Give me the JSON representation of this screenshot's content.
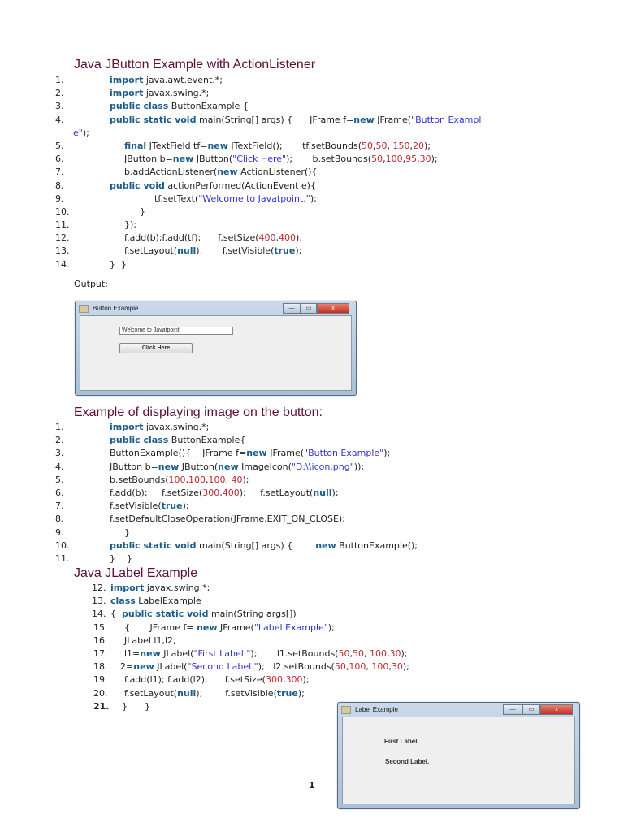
{
  "section1": {
    "heading": "Java JButton Example with ActionListener",
    "lines": [
      {
        "num": "1.",
        "segs": [
          [
            "import",
            "k"
          ],
          [
            " java.awt.event.*;",
            "p"
          ]
        ]
      },
      {
        "num": "2.",
        "segs": [
          [
            "import",
            "k"
          ],
          [
            " javax.swing.*;",
            "p"
          ]
        ]
      },
      {
        "num": "3.",
        "segs": [
          [
            "public class",
            "k"
          ],
          [
            " ButtonExample {",
            "p"
          ]
        ]
      },
      {
        "num": "4.",
        "segs": [
          [
            "public static void",
            "k"
          ],
          [
            " main(String[] args) {      JFrame f=",
            "p"
          ],
          [
            "new",
            "k"
          ],
          [
            " JFrame(",
            "p"
          ],
          [
            "\"Button Exampl",
            "s"
          ]
        ]
      },
      {
        "num": "",
        "segs": [
          [
            "e\"",
            "s"
          ],
          [
            ");",
            "p"
          ]
        ]
      },
      {
        "num": "5.",
        "segs": [
          [
            "final",
            "k"
          ],
          [
            " JTextField tf=",
            "p"
          ],
          [
            "new",
            "k"
          ],
          [
            " JTextField();       tf.setBounds(",
            "p"
          ],
          [
            "50",
            "n"
          ],
          [
            ",",
            "p"
          ],
          [
            "50",
            "n"
          ],
          [
            ", ",
            "p"
          ],
          [
            "150",
            "n"
          ],
          [
            ",",
            "p"
          ],
          [
            "20",
            "n"
          ],
          [
            ");",
            "p"
          ]
        ]
      },
      {
        "num": "6.",
        "segs": [
          [
            "JButton b=",
            "p"
          ],
          [
            "new",
            "k"
          ],
          [
            " JButton(",
            "p"
          ],
          [
            "\"Click Here\"",
            "s"
          ],
          [
            ");       b.setBounds(",
            "p"
          ],
          [
            "50",
            "n"
          ],
          [
            ",",
            "p"
          ],
          [
            "100",
            "n"
          ],
          [
            ",",
            "p"
          ],
          [
            "95",
            "n"
          ],
          [
            ",",
            "p"
          ],
          [
            "30",
            "n"
          ],
          [
            ");",
            "p"
          ]
        ]
      },
      {
        "num": "7.",
        "segs": [
          [
            "b.addActionListener(",
            "p"
          ],
          [
            "new",
            "k"
          ],
          [
            " ActionListener(){",
            "p"
          ]
        ]
      },
      {
        "num": "8.",
        "segs": [
          [
            "public void",
            "k"
          ],
          [
            " actionPerformed(ActionEvent e){",
            "p"
          ]
        ]
      },
      {
        "num": "9.",
        "segs": [
          [
            "tf.setText(",
            "p"
          ],
          [
            "\"Welcome to Javatpoint.\"",
            "s"
          ],
          [
            ");",
            "p"
          ]
        ]
      },
      {
        "num": "10.",
        "segs": [
          [
            "}",
            "p"
          ]
        ]
      },
      {
        "num": "11.",
        "segs": [
          [
            "});",
            "p"
          ]
        ]
      },
      {
        "num": "12.",
        "segs": [
          [
            "f.add(b);f.add(tf);      f.setSize(",
            "p"
          ],
          [
            "400",
            "n"
          ],
          [
            ",",
            "p"
          ],
          [
            "400",
            "n"
          ],
          [
            ");",
            "p"
          ]
        ]
      },
      {
        "num": "13.",
        "segs": [
          [
            "f.setLayout(",
            "p"
          ],
          [
            "null",
            "k"
          ],
          [
            ");       f.setVisible(",
            "p"
          ],
          [
            "true",
            "k"
          ],
          [
            ");",
            "p"
          ]
        ]
      },
      {
        "num": "14.",
        "segs": [
          [
            "}  }",
            "p"
          ]
        ]
      }
    ],
    "output_label": "Output:",
    "window": {
      "title": "Button Example",
      "textfield": "Welcome to Javatpoint.",
      "button": "Click Here",
      "close": "x"
    }
  },
  "section2": {
    "heading": "Example of displaying image on the button:",
    "lines": [
      {
        "num": "1.",
        "segs": [
          [
            "import",
            "k"
          ],
          [
            " javax.swing.*;",
            "p"
          ]
        ]
      },
      {
        "num": "2.",
        "segs": [
          [
            "public class",
            "k"
          ],
          [
            " ButtonExample{",
            "p"
          ]
        ]
      },
      {
        "num": "3.",
        "segs": [
          [
            "ButtonExample(){    JFrame f=",
            "p"
          ],
          [
            "new",
            "k"
          ],
          [
            " JFrame(",
            "p"
          ],
          [
            "\"Button Example\"",
            "s"
          ],
          [
            ");",
            "p"
          ]
        ]
      },
      {
        "num": "4.",
        "segs": [
          [
            "JButton b=",
            "p"
          ],
          [
            "new",
            "k"
          ],
          [
            " JButton(",
            "p"
          ],
          [
            "new",
            "k"
          ],
          [
            " ImageIcon(",
            "p"
          ],
          [
            "\"D:\\\\icon.png\"",
            "s"
          ],
          [
            "));",
            "p"
          ]
        ]
      },
      {
        "num": "5.",
        "segs": [
          [
            "b.setBounds(",
            "p"
          ],
          [
            "100",
            "n"
          ],
          [
            ",",
            "p"
          ],
          [
            "100",
            "n"
          ],
          [
            ",",
            "p"
          ],
          [
            "100",
            "n"
          ],
          [
            ", ",
            "p"
          ],
          [
            "40",
            "n"
          ],
          [
            ");",
            "p"
          ]
        ]
      },
      {
        "num": "6.",
        "segs": [
          [
            "f.add(b);     f.setSize(",
            "p"
          ],
          [
            "300",
            "n"
          ],
          [
            ",",
            "p"
          ],
          [
            "400",
            "n"
          ],
          [
            ");     f.setLayout(",
            "p"
          ],
          [
            "null",
            "k"
          ],
          [
            ");",
            "p"
          ]
        ]
      },
      {
        "num": "7.",
        "segs": [
          [
            "f.setVisible(",
            "p"
          ],
          [
            "true",
            "k"
          ],
          [
            ");",
            "p"
          ]
        ]
      },
      {
        "num": "8.",
        "segs": [
          [
            "f.setDefaultCloseOperation(JFrame.EXIT_ON_CLOSE);",
            "p"
          ]
        ]
      },
      {
        "num": "9.",
        "segs": [
          [
            "}",
            "p"
          ]
        ]
      },
      {
        "num": "10.",
        "segs": [
          [
            "public static void",
            "k"
          ],
          [
            " main(String[] args) {        ",
            "p"
          ],
          [
            "new",
            "k"
          ],
          [
            " ButtonExample();",
            "p"
          ]
        ]
      },
      {
        "num": "11.",
        "segs": [
          [
            "}    }",
            "p"
          ]
        ]
      }
    ]
  },
  "section3": {
    "heading": "Java JLabel Example",
    "lines": [
      {
        "num": "12.",
        "segs": [
          [
            "import",
            "k"
          ],
          [
            " javax.swing.*;",
            "p"
          ]
        ]
      },
      {
        "num": "13.",
        "segs": [
          [
            "class",
            "k"
          ],
          [
            " LabelExample",
            "p"
          ]
        ]
      },
      {
        "num": "14.",
        "segs": [
          [
            "{  ",
            "p"
          ],
          [
            "public static void",
            "k"
          ],
          [
            " main(String args[])",
            "p"
          ]
        ]
      },
      {
        "num": "15.",
        "segs": [
          [
            "{       JFrame f= ",
            "p"
          ],
          [
            "new",
            "k"
          ],
          [
            " JFrame(",
            "p"
          ],
          [
            "\"Label Example\"",
            "s"
          ],
          [
            ");",
            "p"
          ]
        ]
      },
      {
        "num": "16.",
        "segs": [
          [
            "JLabel l1,l2;",
            "p"
          ]
        ]
      },
      {
        "num": "17.",
        "segs": [
          [
            "l1=",
            "p"
          ],
          [
            "new",
            "k"
          ],
          [
            " JLabel(",
            "p"
          ],
          [
            "\"First Label.\"",
            "s"
          ],
          [
            ");       l1.setBounds(",
            "p"
          ],
          [
            "50",
            "n"
          ],
          [
            ",",
            "p"
          ],
          [
            "50",
            "n"
          ],
          [
            ", ",
            "p"
          ],
          [
            "100",
            "n"
          ],
          [
            ",",
            "p"
          ],
          [
            "30",
            "n"
          ],
          [
            ");",
            "p"
          ]
        ]
      },
      {
        "num": "18.",
        "segs": [
          [
            "l2=",
            "p"
          ],
          [
            "new",
            "k"
          ],
          [
            " JLabel(",
            "p"
          ],
          [
            "\"Second Label.\"",
            "s"
          ],
          [
            ");   l2.setBounds(",
            "p"
          ],
          [
            "50",
            "n"
          ],
          [
            ",",
            "p"
          ],
          [
            "100",
            "n"
          ],
          [
            ", ",
            "p"
          ],
          [
            "100",
            "n"
          ],
          [
            ",",
            "p"
          ],
          [
            "30",
            "n"
          ],
          [
            ");",
            "p"
          ]
        ]
      },
      {
        "num": "19.",
        "segs": [
          [
            "f.add(l1); f.add(l2);      f.setSize(",
            "p"
          ],
          [
            "300",
            "n"
          ],
          [
            ",",
            "p"
          ],
          [
            "300",
            "n"
          ],
          [
            ");",
            "p"
          ]
        ]
      },
      {
        "num": "20.",
        "segs": [
          [
            "f.setLayout(",
            "p"
          ],
          [
            "null",
            "k"
          ],
          [
            ");        f.setVisible(",
            "p"
          ],
          [
            "true",
            "k"
          ],
          [
            ");",
            "p"
          ]
        ]
      },
      {
        "num": "21.",
        "segs": [
          [
            "}      }",
            "p"
          ]
        ]
      }
    ],
    "window": {
      "title": "Label Example",
      "label1": "First Label.",
      "label2": "Second Label.",
      "close": "x"
    }
  },
  "page_number": "1"
}
